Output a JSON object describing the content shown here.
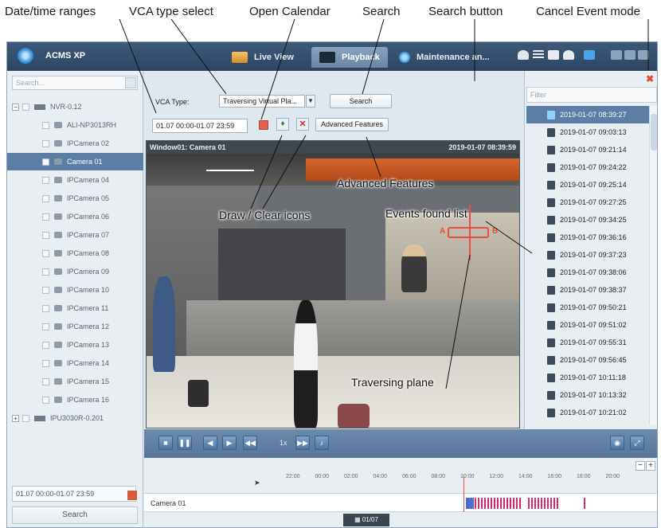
{
  "callouts": {
    "date_time_ranges": "Date/time ranges",
    "vca_type_select": "VCA type select",
    "open_calendar": "Open Calendar",
    "search": "Search",
    "search_button": "Search button",
    "cancel_event_mode": "Cancel Event mode",
    "advanced_features": "Advanced Features",
    "draw_clear_icons": "Draw / Clear icons",
    "events_found_list": "Events found list",
    "traversing_plane": "Traversing plane"
  },
  "titlebar": {
    "app_name": "ACMS XP",
    "tabs": [
      {
        "label": "Live View",
        "active": false
      },
      {
        "label": "Playback",
        "active": true
      },
      {
        "label": "Maintenance an...",
        "active": false
      }
    ]
  },
  "left_panel": {
    "search_placeholder": "Search...",
    "tree": [
      {
        "label": "NVR-0.12",
        "kind": "nvr"
      },
      {
        "label": "ALI-NP3013RH",
        "kind": "camera"
      },
      {
        "label": "IPCamera 02",
        "kind": "camera"
      },
      {
        "label": "Camera 01",
        "kind": "camera",
        "selected": true
      },
      {
        "label": "IPCamera 04",
        "kind": "camera"
      },
      {
        "label": "IPCamera 05",
        "kind": "camera"
      },
      {
        "label": "IPCamera 06",
        "kind": "camera"
      },
      {
        "label": "IPCamera 07",
        "kind": "camera"
      },
      {
        "label": "IPCamera 08",
        "kind": "camera"
      },
      {
        "label": "IPCamera 09",
        "kind": "camera"
      },
      {
        "label": "IPCamera 10",
        "kind": "camera"
      },
      {
        "label": "IPCamera 11",
        "kind": "camera"
      },
      {
        "label": "IPCamera 12",
        "kind": "camera"
      },
      {
        "label": "IPCamera 13",
        "kind": "camera"
      },
      {
        "label": "IPCamera 14",
        "kind": "camera"
      },
      {
        "label": "IPCamera 15",
        "kind": "camera"
      },
      {
        "label": "IPCamera 16",
        "kind": "camera"
      },
      {
        "label": "IPU3030R-0.201",
        "kind": "nvr"
      }
    ],
    "date_range": "01.07 00:00-01.07 23:59",
    "search_label": "Search"
  },
  "vca": {
    "type_label": "VCA Type:",
    "type_value": "Traversing Virtual Pla...",
    "search_label": "Search",
    "date_range": "01.07 00:00-01.07 23:59",
    "advanced_label": "Advanced Features"
  },
  "video": {
    "window_label": "Window01: Camera 01",
    "timestamp": "2019-01-07 08:39:59",
    "plane_letters": [
      "A",
      "B"
    ]
  },
  "right_panel": {
    "filter_placeholder": "Filter",
    "events": [
      "2019-01-07 08:39:27",
      "2019-01-07 09:03:13",
      "2019-01-07 09:21:14",
      "2019-01-07 09:24:22",
      "2019-01-07 09:25:14",
      "2019-01-07 09:27:25",
      "2019-01-07 09:34:25",
      "2019-01-07 09:36:16",
      "2019-01-07 09:37:23",
      "2019-01-07 09:38:06",
      "2019-01-07 09:38:37",
      "2019-01-07 09:50:21",
      "2019-01-07 09:51:02",
      "2019-01-07 09:55:31",
      "2019-01-07 09:56:45",
      "2019-01-07 10:11:18",
      "2019-01-07 10:13:32",
      "2019-01-07 10:21:02"
    ],
    "selected_index": 0
  },
  "playback": {
    "speed": "1x"
  },
  "timeline": {
    "ticks": [
      "22:00",
      "00:00",
      "02:00",
      "04:00",
      "06:00",
      "08:00",
      "10:00",
      "12:00",
      "14:00",
      "16:00",
      "18:00",
      "20:00"
    ],
    "camera_label": "Camera 01",
    "date_label": "01/07"
  },
  "icons": {
    "calendar": "calendar-icon",
    "draw": "draw-icon",
    "clear": "clear-icon",
    "cancel": "cancel-icon"
  },
  "colors": {
    "titlebar": "#2c4562",
    "selection": "#5a7ea6",
    "event_marker": "#d92a6b",
    "cursor": "#e84d40"
  }
}
